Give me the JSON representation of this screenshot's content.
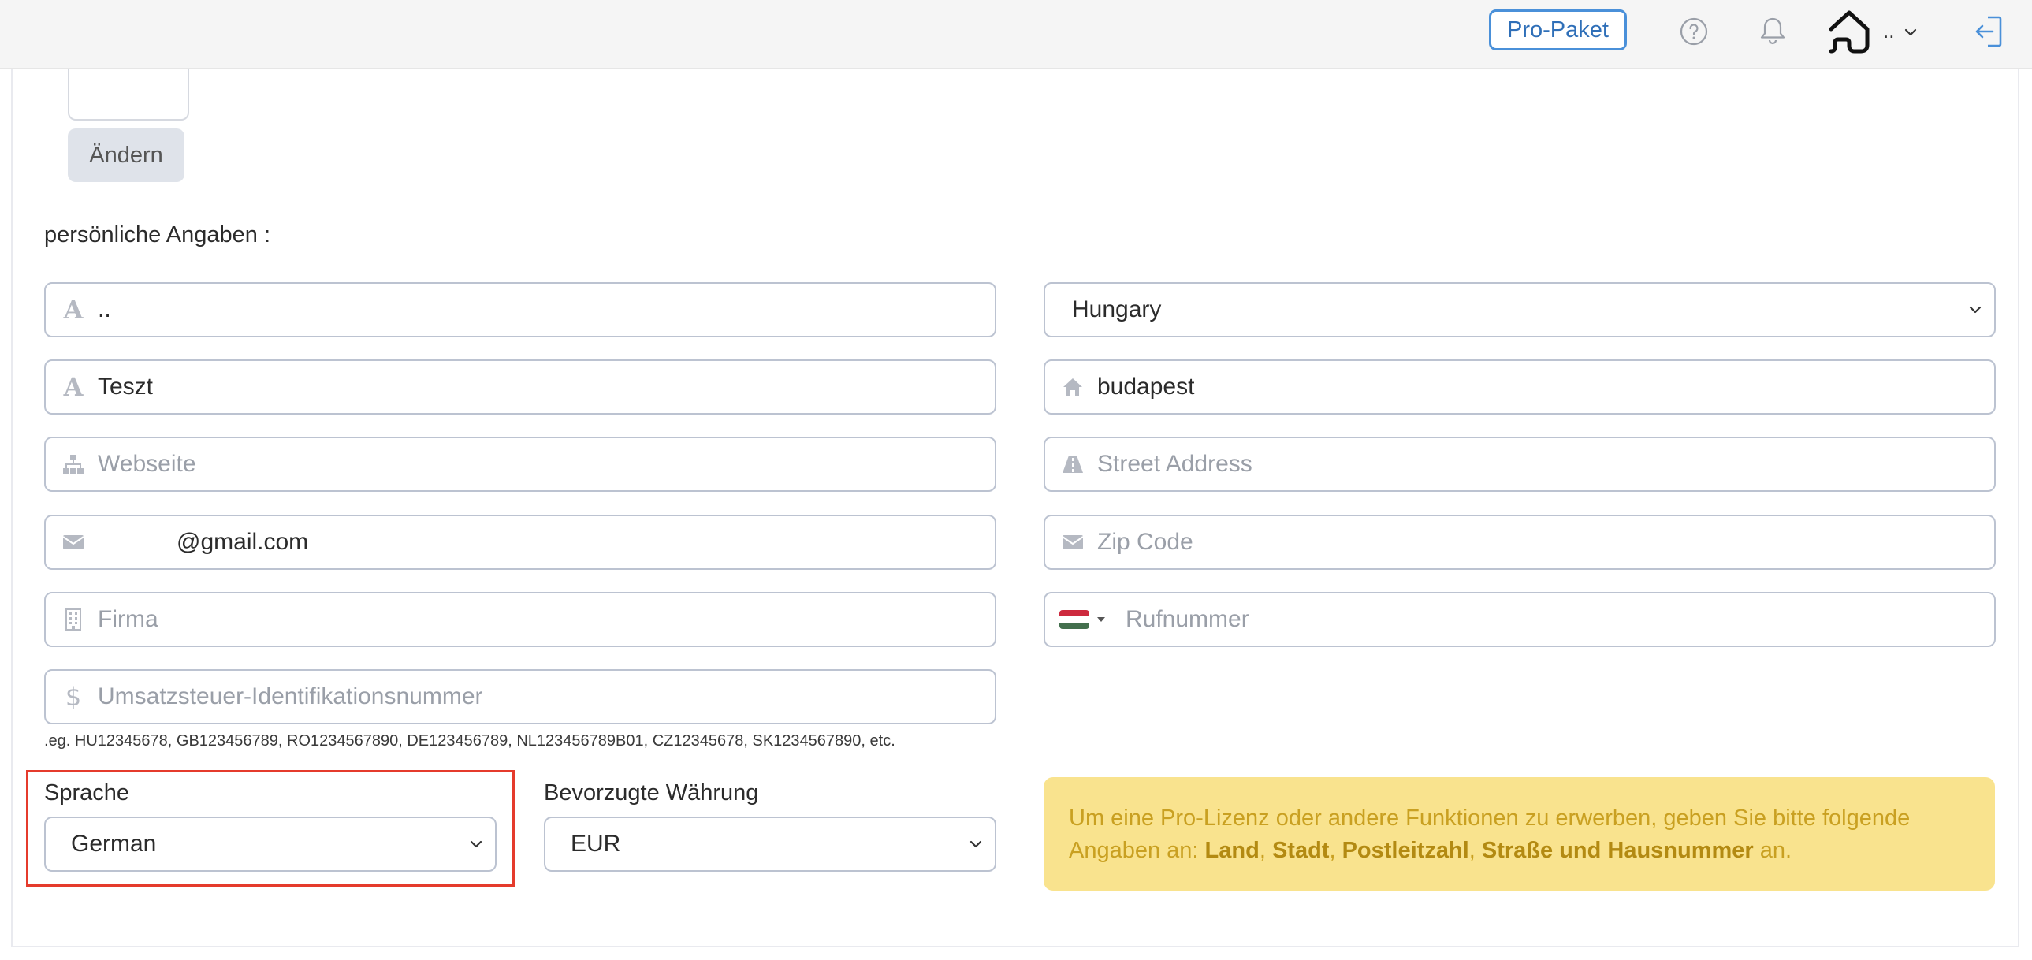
{
  "header": {
    "pro_button": "Pro-Paket",
    "user_name": "..",
    "icons": [
      "question-circle-icon",
      "bell-icon",
      "home-avatar",
      "chevron-down-icon",
      "logout-icon"
    ]
  },
  "profile": {
    "change_button": "Ändern",
    "section_title": "persönliche Angaben :"
  },
  "form": {
    "first_name": {
      "value": "..",
      "placeholder": ""
    },
    "last_name": {
      "value": "Teszt",
      "placeholder": ""
    },
    "website": {
      "value": "",
      "placeholder": "Webseite"
    },
    "email": {
      "value": "            @gmail.com",
      "placeholder": ""
    },
    "company": {
      "value": "",
      "placeholder": "Firma"
    },
    "vat": {
      "value": "",
      "placeholder": "Umsatzsteuer-Identifikationsnummer"
    },
    "vat_hint": ".eg. HU12345678, GB123456789, RO1234567890, DE123456789, NL123456789B01, CZ12345678, SK1234567890, etc.",
    "country": {
      "value": "Hungary"
    },
    "city": {
      "value": "budapest",
      "placeholder": ""
    },
    "street": {
      "value": "",
      "placeholder": "Street Address"
    },
    "zip": {
      "value": "",
      "placeholder": "Zip Code"
    },
    "phone": {
      "value": "",
      "placeholder": "Rufnummer",
      "flag_colors": [
        "#cd2a3e",
        "#ffffff",
        "#436f4d"
      ]
    },
    "language": {
      "label": "Sprache",
      "value": "German"
    },
    "currency": {
      "label": "Bevorzugte Währung",
      "value": "EUR"
    }
  },
  "notice": {
    "text_before": "Um eine Pro-Lizenz oder andere Funktionen zu erwerben, geben Sie bitte folgende Angaben an: ",
    "country": "Land",
    "sep1": ", ",
    "city": "Stadt",
    "sep2": ", ",
    "zip": "Postleitzahl",
    "sep3": ", ",
    "street": "Straße und Hausnummer",
    "text_after": " an."
  },
  "colors": {
    "accent": "#4a90d9",
    "highlight_border": "#e53b2c",
    "notice_bg": "#f9e38e",
    "notice_text": "#c9a021"
  }
}
